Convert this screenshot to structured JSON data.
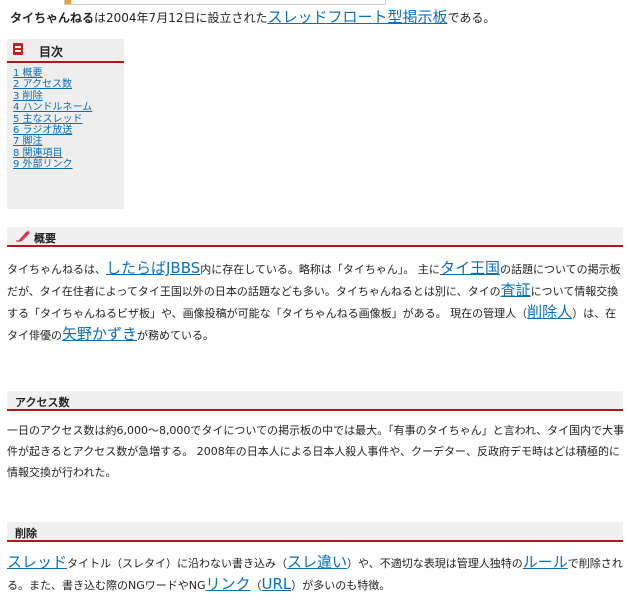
{
  "intro": {
    "name": "タイちゃんねる",
    "text1": "は2004年7月12日に設立された",
    "link_text": "スレッドフロート型掲示板",
    "text2": "である。"
  },
  "toc": {
    "title": "目次",
    "items": [
      "1 概要",
      "2 アクセス数",
      "3 削除",
      "4 ハンドルネーム",
      "5 主なスレッド",
      "6 ラジオ放送",
      "7 脚注",
      "8 関連項目",
      "9 外部リンク"
    ]
  },
  "sections": {
    "overview": {
      "heading": "概要",
      "p1": "タイちゃんねるは、",
      "link1": "したらばJBBS",
      "p2": "内に存在している。略称は「タイちゃん」。 主に",
      "link2": "タイ王国",
      "p3": "の話題についての掲示板だが、タイ在住者によってタイ王国以外の日本の話題なども多い。タイちゃんねるとは別に、タイの",
      "link3": "査証",
      "p4": "について情報交換する「タイちゃんねるビザ板」や、画像投稿が可能な「タイちゃんねる画像板」がある。 現在の管理人（",
      "link4": "削除人",
      "p5": "）は、在タイ俳優の",
      "link5": "矢野かずき",
      "p6": "が務めている。"
    },
    "access": {
      "heading": "アクセス数",
      "text": "一日のアクセス数は約6,000〜8,000でタイについての掲示板の中では最大。「有事のタイちゃん」と言われ、タイ国内で大事件が起きるとアクセス数が急増する。 2008年の日本人による日本人殺人事件や、クーデター、反政府デモ時はどは積極的に情報交換が行われた。"
    },
    "deletion": {
      "heading": "削除",
      "link1": "スレッド",
      "p1": "タイトル（スレタイ）に沿わない書き込み（",
      "link2": "スレ違い",
      "p2": "）や、不適切な表現は管理人独特の",
      "link3": "ルール",
      "p3": "で削除される。また、書き込む際のNGワードやNG",
      "link4": "リンク",
      "p4": "（",
      "link5": "URL",
      "p5": "）が多いのも特徴。"
    }
  },
  "colors": {
    "link": "#0b6fb8",
    "heading_rule": "#b01818",
    "toc_background": "#eeeeee"
  }
}
